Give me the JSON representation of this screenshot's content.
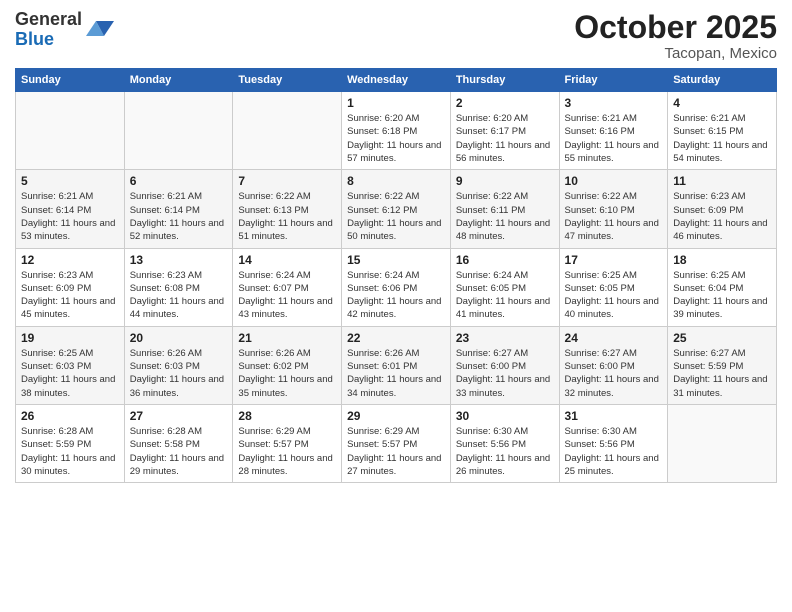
{
  "logo": {
    "general": "General",
    "blue": "Blue"
  },
  "title": "October 2025",
  "subtitle": "Tacopan, Mexico",
  "days_of_week": [
    "Sunday",
    "Monday",
    "Tuesday",
    "Wednesday",
    "Thursday",
    "Friday",
    "Saturday"
  ],
  "weeks": [
    [
      {
        "day": "",
        "info": ""
      },
      {
        "day": "",
        "info": ""
      },
      {
        "day": "",
        "info": ""
      },
      {
        "day": "1",
        "info": "Sunrise: 6:20 AM\nSunset: 6:18 PM\nDaylight: 11 hours and 57 minutes."
      },
      {
        "day": "2",
        "info": "Sunrise: 6:20 AM\nSunset: 6:17 PM\nDaylight: 11 hours and 56 minutes."
      },
      {
        "day": "3",
        "info": "Sunrise: 6:21 AM\nSunset: 6:16 PM\nDaylight: 11 hours and 55 minutes."
      },
      {
        "day": "4",
        "info": "Sunrise: 6:21 AM\nSunset: 6:15 PM\nDaylight: 11 hours and 54 minutes."
      }
    ],
    [
      {
        "day": "5",
        "info": "Sunrise: 6:21 AM\nSunset: 6:14 PM\nDaylight: 11 hours and 53 minutes."
      },
      {
        "day": "6",
        "info": "Sunrise: 6:21 AM\nSunset: 6:14 PM\nDaylight: 11 hours and 52 minutes."
      },
      {
        "day": "7",
        "info": "Sunrise: 6:22 AM\nSunset: 6:13 PM\nDaylight: 11 hours and 51 minutes."
      },
      {
        "day": "8",
        "info": "Sunrise: 6:22 AM\nSunset: 6:12 PM\nDaylight: 11 hours and 50 minutes."
      },
      {
        "day": "9",
        "info": "Sunrise: 6:22 AM\nSunset: 6:11 PM\nDaylight: 11 hours and 48 minutes."
      },
      {
        "day": "10",
        "info": "Sunrise: 6:22 AM\nSunset: 6:10 PM\nDaylight: 11 hours and 47 minutes."
      },
      {
        "day": "11",
        "info": "Sunrise: 6:23 AM\nSunset: 6:09 PM\nDaylight: 11 hours and 46 minutes."
      }
    ],
    [
      {
        "day": "12",
        "info": "Sunrise: 6:23 AM\nSunset: 6:09 PM\nDaylight: 11 hours and 45 minutes."
      },
      {
        "day": "13",
        "info": "Sunrise: 6:23 AM\nSunset: 6:08 PM\nDaylight: 11 hours and 44 minutes."
      },
      {
        "day": "14",
        "info": "Sunrise: 6:24 AM\nSunset: 6:07 PM\nDaylight: 11 hours and 43 minutes."
      },
      {
        "day": "15",
        "info": "Sunrise: 6:24 AM\nSunset: 6:06 PM\nDaylight: 11 hours and 42 minutes."
      },
      {
        "day": "16",
        "info": "Sunrise: 6:24 AM\nSunset: 6:05 PM\nDaylight: 11 hours and 41 minutes."
      },
      {
        "day": "17",
        "info": "Sunrise: 6:25 AM\nSunset: 6:05 PM\nDaylight: 11 hours and 40 minutes."
      },
      {
        "day": "18",
        "info": "Sunrise: 6:25 AM\nSunset: 6:04 PM\nDaylight: 11 hours and 39 minutes."
      }
    ],
    [
      {
        "day": "19",
        "info": "Sunrise: 6:25 AM\nSunset: 6:03 PM\nDaylight: 11 hours and 38 minutes."
      },
      {
        "day": "20",
        "info": "Sunrise: 6:26 AM\nSunset: 6:03 PM\nDaylight: 11 hours and 36 minutes."
      },
      {
        "day": "21",
        "info": "Sunrise: 6:26 AM\nSunset: 6:02 PM\nDaylight: 11 hours and 35 minutes."
      },
      {
        "day": "22",
        "info": "Sunrise: 6:26 AM\nSunset: 6:01 PM\nDaylight: 11 hours and 34 minutes."
      },
      {
        "day": "23",
        "info": "Sunrise: 6:27 AM\nSunset: 6:00 PM\nDaylight: 11 hours and 33 minutes."
      },
      {
        "day": "24",
        "info": "Sunrise: 6:27 AM\nSunset: 6:00 PM\nDaylight: 11 hours and 32 minutes."
      },
      {
        "day": "25",
        "info": "Sunrise: 6:27 AM\nSunset: 5:59 PM\nDaylight: 11 hours and 31 minutes."
      }
    ],
    [
      {
        "day": "26",
        "info": "Sunrise: 6:28 AM\nSunset: 5:59 PM\nDaylight: 11 hours and 30 minutes."
      },
      {
        "day": "27",
        "info": "Sunrise: 6:28 AM\nSunset: 5:58 PM\nDaylight: 11 hours and 29 minutes."
      },
      {
        "day": "28",
        "info": "Sunrise: 6:29 AM\nSunset: 5:57 PM\nDaylight: 11 hours and 28 minutes."
      },
      {
        "day": "29",
        "info": "Sunrise: 6:29 AM\nSunset: 5:57 PM\nDaylight: 11 hours and 27 minutes."
      },
      {
        "day": "30",
        "info": "Sunrise: 6:30 AM\nSunset: 5:56 PM\nDaylight: 11 hours and 26 minutes."
      },
      {
        "day": "31",
        "info": "Sunrise: 6:30 AM\nSunset: 5:56 PM\nDaylight: 11 hours and 25 minutes."
      },
      {
        "day": "",
        "info": ""
      }
    ]
  ]
}
